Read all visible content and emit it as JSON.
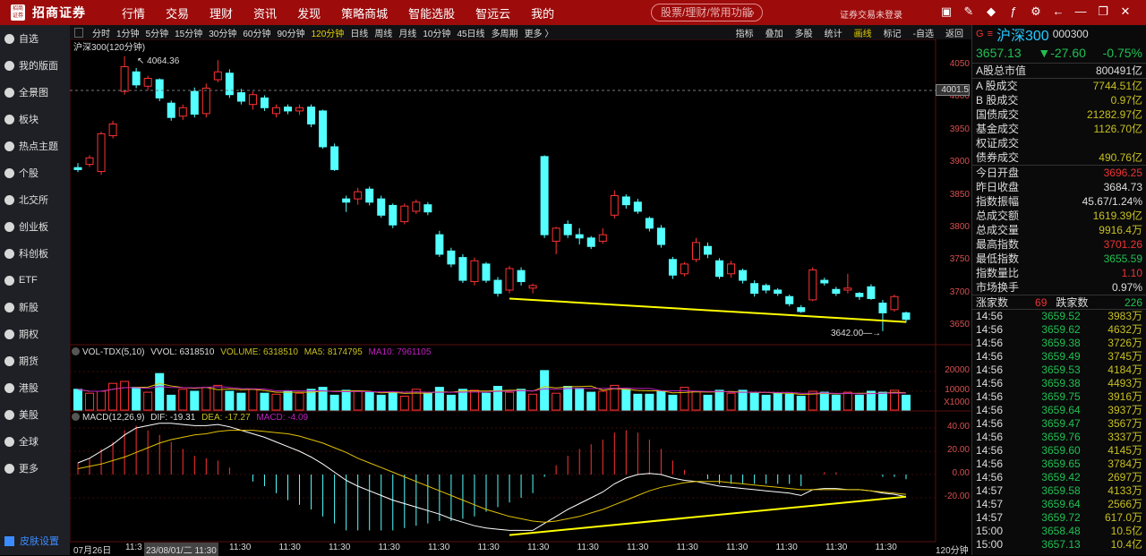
{
  "app": {
    "logo_text": "招商证券",
    "logo_mark": "招商证券"
  },
  "menu": [
    "行情",
    "交易",
    "理财",
    "资讯",
    "发现",
    "策略商城",
    "智能选股",
    "智远云",
    "我的"
  ],
  "search": {
    "placeholder": "股票/理财/常用功能"
  },
  "login_status": "证券交易未登录",
  "window_icons": [
    "layout-icon",
    "edit-icon",
    "box-icon",
    "fx-icon",
    "gear-icon",
    "back-arrow-icon",
    "minimize-icon",
    "restore-icon",
    "close-icon"
  ],
  "sidebar": {
    "items": [
      "自选",
      "我的版面",
      "全景图",
      "板块",
      "热点主题",
      "个股",
      "北交所",
      "创业板",
      "科创板",
      "ETF",
      "新股",
      "期权",
      "期货",
      "港股",
      "美股",
      "全球",
      "更多"
    ],
    "bottom": "皮肤设置"
  },
  "periods": [
    "分时",
    "1分钟",
    "5分钟",
    "15分钟",
    "30分钟",
    "60分钟",
    "90分钟",
    "120分钟",
    "日线",
    "周线",
    "月线",
    "10分钟",
    "45日线",
    "多周期",
    "更多 〉"
  ],
  "active_period": "120分钟",
  "tools": [
    "指标",
    "叠加",
    "多股",
    "统计",
    "画线",
    "标记",
    "-自选",
    "返回"
  ],
  "chart_title": "沪深300(120分钟)",
  "annotations": {
    "high": "4064.36",
    "low": "3642.00",
    "cursor_price": "4001.5"
  },
  "vol_header": {
    "name": "VOL-TDX(5,10)",
    "vvol": "VVOL: 6318510",
    "volume": "VOLUME: 6318510",
    "ma5": "MA5: 8174795",
    "ma10": "MA10: 7961105"
  },
  "macd_header": {
    "name": "MACD(12,26,9)",
    "dif": "DIF: -19.31",
    "dea": "DEA: -17.27",
    "macd": "MACD: -4.09"
  },
  "price_ticks": [
    "4050",
    "4000",
    "3950",
    "3900",
    "3850",
    "3800",
    "3750",
    "3700",
    "3650"
  ],
  "vol_ticks": [
    "20000",
    "10000",
    "X1000"
  ],
  "macd_ticks": [
    "40.00",
    "20.00",
    "0.00",
    "-20.00"
  ],
  "x_labels": [
    "07月26日",
    "11:3",
    "23/08/01/二 11:30",
    "11:30",
    "11:30",
    "11:30",
    "11:30",
    "11:30",
    "11:30",
    "11:30",
    "11:30",
    "11:30",
    "11:30",
    "11:30",
    "11:30",
    "11:30",
    "11:30",
    "120分钟"
  ],
  "quote": {
    "flag": "G",
    "name": "沪深300",
    "code": "000300",
    "price": "3657.13",
    "change": "▼-27.60",
    "pct": "-0.75%"
  },
  "stats_a": [
    {
      "k": "A股总市值",
      "v": "800491亿",
      "c": "w"
    }
  ],
  "stats_b": [
    {
      "k": "A 股成交",
      "v": "7744.51亿",
      "c": "y"
    },
    {
      "k": "B 股成交",
      "v": "0.97亿",
      "c": "y"
    },
    {
      "k": "国债成交",
      "v": "21282.97亿",
      "c": "y"
    },
    {
      "k": "基金成交",
      "v": "1126.70亿",
      "c": "y"
    },
    {
      "k": "权证成交",
      "v": "",
      "c": "y"
    },
    {
      "k": "债券成交",
      "v": "490.76亿",
      "c": "y"
    }
  ],
  "stats_c": [
    {
      "k": "今日开盘",
      "v": "3696.25",
      "c": "r"
    },
    {
      "k": "昨日收盘",
      "v": "3684.73",
      "c": "w"
    },
    {
      "k": "指数振幅",
      "v": "45.67/1.24%",
      "c": "w"
    },
    {
      "k": "总成交额",
      "v": "1619.39亿",
      "c": "y"
    },
    {
      "k": "总成交量",
      "v": "9916.4万",
      "c": "y"
    },
    {
      "k": "最高指数",
      "v": "3701.26",
      "c": "r"
    },
    {
      "k": "最低指数",
      "v": "3655.59",
      "c": "g"
    },
    {
      "k": "指数量比",
      "v": "1.10",
      "c": "r"
    },
    {
      "k": "市场换手",
      "v": "0.97%",
      "c": "w"
    }
  ],
  "breadth": {
    "up_label": "涨家数",
    "up": "69",
    "down_label": "跌家数",
    "down": "226"
  },
  "ticks": [
    [
      "14:56",
      "3659.52",
      "3983万"
    ],
    [
      "14:56",
      "3659.62",
      "4632万"
    ],
    [
      "14:56",
      "3659.38",
      "3726万"
    ],
    [
      "14:56",
      "3659.49",
      "3745万"
    ],
    [
      "14:56",
      "3659.53",
      "4184万"
    ],
    [
      "14:56",
      "3659.38",
      "4493万"
    ],
    [
      "14:56",
      "3659.75",
      "3916万"
    ],
    [
      "14:56",
      "3659.64",
      "3937万"
    ],
    [
      "14:56",
      "3659.47",
      "3567万"
    ],
    [
      "14:56",
      "3659.76",
      "3337万"
    ],
    [
      "14:56",
      "3659.60",
      "4145万"
    ],
    [
      "14:56",
      "3659.65",
      "3784万"
    ],
    [
      "14:56",
      "3659.42",
      "2697万"
    ],
    [
      "14:57",
      "3659.58",
      "4133万"
    ],
    [
      "14:57",
      "3659.64",
      "2566万"
    ],
    [
      "14:57",
      "3659.72",
      "617.0万"
    ],
    [
      "15:00",
      "3658.48",
      "10.5亿"
    ],
    [
      "15:00",
      "3657.13",
      "10.4亿"
    ]
  ],
  "colors": {
    "up": "#ff3232",
    "down": "#54ffff",
    "trend": "#ffff00",
    "dif": "#ffffff",
    "dea": "#e0c000",
    "ma10": "#c020c0"
  },
  "chart_data": {
    "type": "candlestick",
    "price_range": [
      3650,
      4050
    ],
    "candles": [
      [
        3893,
        3900,
        3886,
        3890
      ],
      [
        3898,
        3912,
        3894,
        3908
      ],
      [
        3887,
        3948,
        3882,
        3945
      ],
      [
        3942,
        3965,
        3938,
        3960
      ],
      [
        4010,
        4064,
        4005,
        4048
      ],
      [
        4040,
        4046,
        4015,
        4020
      ],
      [
        4018,
        4034,
        4012,
        4030
      ],
      [
        4028,
        4030,
        3995,
        4000
      ],
      [
        3992,
        3996,
        3965,
        3970
      ],
      [
        3972,
        3990,
        3966,
        3985
      ],
      [
        4010,
        4016,
        3970,
        3975
      ],
      [
        3976,
        4022,
        3970,
        4015
      ],
      [
        4028,
        4058,
        4024,
        4040
      ],
      [
        4038,
        4044,
        4000,
        4005
      ],
      [
        4008,
        4014,
        3990,
        3995
      ],
      [
        3990,
        4010,
        3982,
        4005
      ],
      [
        4000,
        4004,
        3980,
        3985
      ],
      [
        3976,
        3990,
        3970,
        3985
      ],
      [
        3986,
        3990,
        3975,
        3980
      ],
      [
        3980,
        3990,
        3974,
        3985
      ],
      [
        3986,
        3990,
        3955,
        3960
      ],
      [
        3980,
        3982,
        3922,
        3925
      ],
      [
        3925,
        3930,
        3888,
        3890
      ],
      [
        3845,
        3850,
        3825,
        3840
      ],
      [
        3845,
        3862,
        3836,
        3856
      ],
      [
        3860,
        3864,
        3835,
        3840
      ],
      [
        3845,
        3850,
        3816,
        3820
      ],
      [
        3835,
        3838,
        3800,
        3805
      ],
      [
        3810,
        3838,
        3806,
        3834
      ],
      [
        3826,
        3844,
        3822,
        3840
      ],
      [
        3836,
        3840,
        3820,
        3825
      ],
      [
        3790,
        3796,
        3756,
        3760
      ],
      [
        3765,
        3770,
        3740,
        3745
      ],
      [
        3755,
        3760,
        3716,
        3720
      ],
      [
        3718,
        3755,
        3712,
        3750
      ],
      [
        3745,
        3748,
        3716,
        3720
      ],
      [
        3720,
        3725,
        3695,
        3700
      ],
      [
        3705,
        3742,
        3700,
        3738
      ],
      [
        3735,
        3740,
        3712,
        3718
      ],
      [
        3708,
        3715,
        3700,
        3712
      ],
      [
        3910,
        3912,
        3785,
        3790
      ],
      [
        3780,
        3802,
        3760,
        3800
      ],
      [
        3806,
        3812,
        3785,
        3790
      ],
      [
        3790,
        3800,
        3775,
        3785
      ],
      [
        3785,
        3788,
        3768,
        3772
      ],
      [
        3780,
        3800,
        3776,
        3790
      ],
      [
        3820,
        3858,
        3815,
        3850
      ],
      [
        3848,
        3852,
        3830,
        3836
      ],
      [
        3840,
        3845,
        3822,
        3826
      ],
      [
        3815,
        3818,
        3795,
        3800
      ],
      [
        3800,
        3805,
        3770,
        3775
      ],
      [
        3752,
        3756,
        3722,
        3728
      ],
      [
        3730,
        3748,
        3726,
        3745
      ],
      [
        3752,
        3785,
        3748,
        3778
      ],
      [
        3772,
        3778,
        3754,
        3760
      ],
      [
        3750,
        3754,
        3722,
        3726
      ],
      [
        3730,
        3750,
        3724,
        3745
      ],
      [
        3735,
        3738,
        3715,
        3720
      ],
      [
        3715,
        3720,
        3695,
        3700
      ],
      [
        3712,
        3715,
        3700,
        3705
      ],
      [
        3705,
        3708,
        3696,
        3700
      ],
      [
        3695,
        3698,
        3680,
        3684
      ],
      [
        3678,
        3682,
        3670,
        3672
      ],
      [
        3690,
        3740,
        3688,
        3736
      ],
      [
        3720,
        3724,
        3712,
        3716
      ],
      [
        3706,
        3710,
        3696,
        3700
      ],
      [
        3705,
        3730,
        3700,
        3708
      ],
      [
        3700,
        3702,
        3690,
        3695
      ],
      [
        3710,
        3714,
        3690,
        3692
      ],
      [
        3685,
        3690,
        3642,
        3670
      ],
      [
        3675,
        3698,
        3672,
        3695
      ],
      [
        3670,
        3672,
        3655,
        3660
      ]
    ],
    "volume": [
      11000,
      9000,
      10000,
      14000,
      15000,
      12000,
      9500,
      19000,
      8000,
      11000,
      10000,
      12000,
      13000,
      10000,
      9000,
      11000,
      9000,
      8500,
      10000,
      9000,
      11000,
      12000,
      8000,
      10500,
      10000,
      9500,
      8000,
      9500,
      7500,
      11000,
      9000,
      12000,
      8000,
      11000,
      10500,
      9000,
      12500,
      9500,
      11000,
      8500,
      20500,
      9000,
      12500,
      11500,
      9500,
      10000,
      13000,
      11000,
      8500,
      8500,
      10000,
      8000,
      12000,
      10000,
      8000,
      10500,
      9000,
      10500,
      9000,
      8000,
      9000,
      8500,
      7500,
      10000,
      9500,
      8000,
      9500,
      8000,
      10000,
      9500,
      10500,
      8000
    ],
    "volume_range": [
      0,
      25000
    ],
    "dif": [
      10,
      14,
      20,
      26,
      34,
      40,
      42,
      44,
      44,
      43,
      42,
      42,
      43,
      41,
      38,
      35,
      32,
      28,
      24,
      20,
      15,
      9,
      2,
      -5,
      -10,
      -14,
      -18,
      -22,
      -25,
      -28,
      -31,
      -34,
      -38,
      -41,
      -44,
      -46,
      -47,
      -48,
      -48,
      -48,
      -42,
      -36,
      -30,
      -25,
      -20,
      -15,
      -8,
      -3,
      0,
      1,
      0,
      -3,
      -5,
      -6,
      -8,
      -10,
      -11,
      -12,
      -13,
      -14,
      -15,
      -16,
      -18,
      -13,
      -12,
      -12,
      -13,
      -13,
      -14,
      -16,
      -17,
      -19
    ],
    "dea": [
      5,
      7,
      9,
      12,
      15,
      19,
      23,
      27,
      30,
      32,
      34,
      35,
      37,
      38,
      38,
      38,
      37,
      36,
      35,
      33,
      30,
      27,
      23,
      19,
      14,
      10,
      6,
      2,
      -2,
      -6,
      -10,
      -14,
      -18,
      -22,
      -26,
      -30,
      -33,
      -36,
      -38,
      -40,
      -41,
      -40,
      -38,
      -36,
      -33,
      -30,
      -26,
      -22,
      -18,
      -14,
      -11,
      -9,
      -7,
      -6,
      -6,
      -6,
      -7,
      -8,
      -9,
      -10,
      -11,
      -12,
      -13,
      -13,
      -13,
      -13,
      -13,
      -13,
      -14,
      -15,
      -16,
      -17
    ],
    "macd_range": [
      -30,
      50
    ],
    "trendline_price": {
      "from_index": 37,
      "from": 3692,
      "to_index": 71,
      "to": 3656
    },
    "trendline_macd": {
      "from_index": 37,
      "from": -52,
      "to_index": 71,
      "to": -19
    }
  }
}
